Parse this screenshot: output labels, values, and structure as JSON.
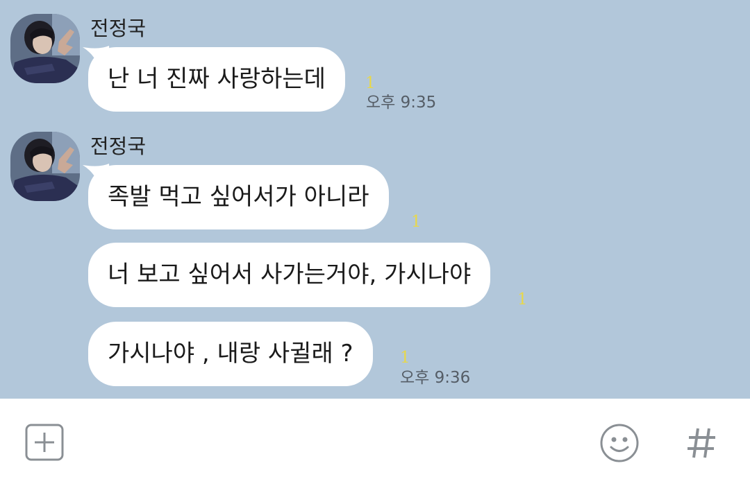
{
  "colors": {
    "chat_background": "#b2c7da",
    "bubble": "#ffffff",
    "unread_count": "#e8d84a",
    "icon_gray": "#8a8f94"
  },
  "groups": [
    {
      "sender": "전정국",
      "messages": [
        {
          "text": "난 너 진짜 사랑하는데",
          "unread": "1",
          "time": "오후 9:35"
        }
      ]
    },
    {
      "sender": "전정국",
      "messages": [
        {
          "text": "족발 먹고 싶어서가 아니라",
          "unread": "1",
          "time": ""
        },
        {
          "text": "너 보고 싶어서 사가는거야, 가시나야",
          "unread": "1",
          "time": ""
        },
        {
          "text": "가시나야 , 내랑 사귈래 ?",
          "unread": "1",
          "time": "오후 9:36"
        }
      ]
    }
  ],
  "input_bar": {
    "add_icon": "plus-square-icon",
    "emoji_icon": "smiley-icon",
    "hashtag_icon": "hash-icon"
  }
}
